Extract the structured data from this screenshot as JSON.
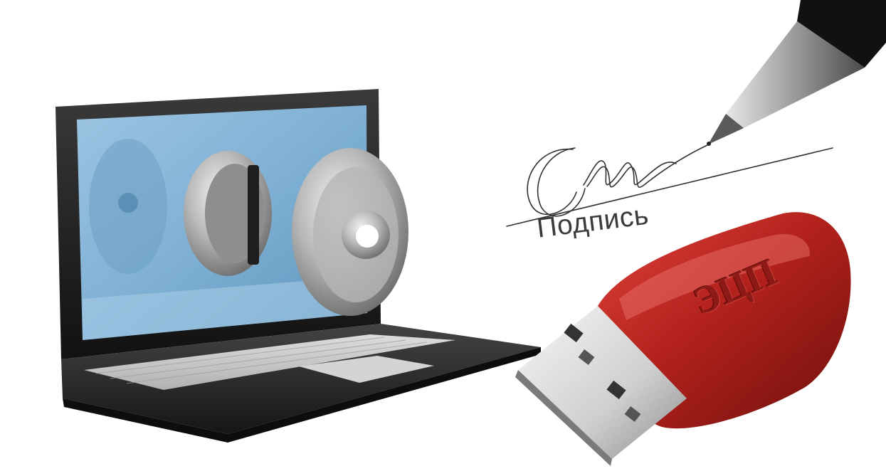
{
  "signature": {
    "caption": "Подпись"
  },
  "usb_token": {
    "label": "ЭЦП"
  },
  "colors": {
    "screen": "#7fb0d4",
    "laptop_body": "#1d1d1d",
    "token_red": "#b4221d",
    "metal": "#c9c9c9"
  },
  "icons": [
    "laptop-icon",
    "key-icon",
    "pen-icon",
    "usb-token-icon",
    "signature-scribble-icon"
  ]
}
